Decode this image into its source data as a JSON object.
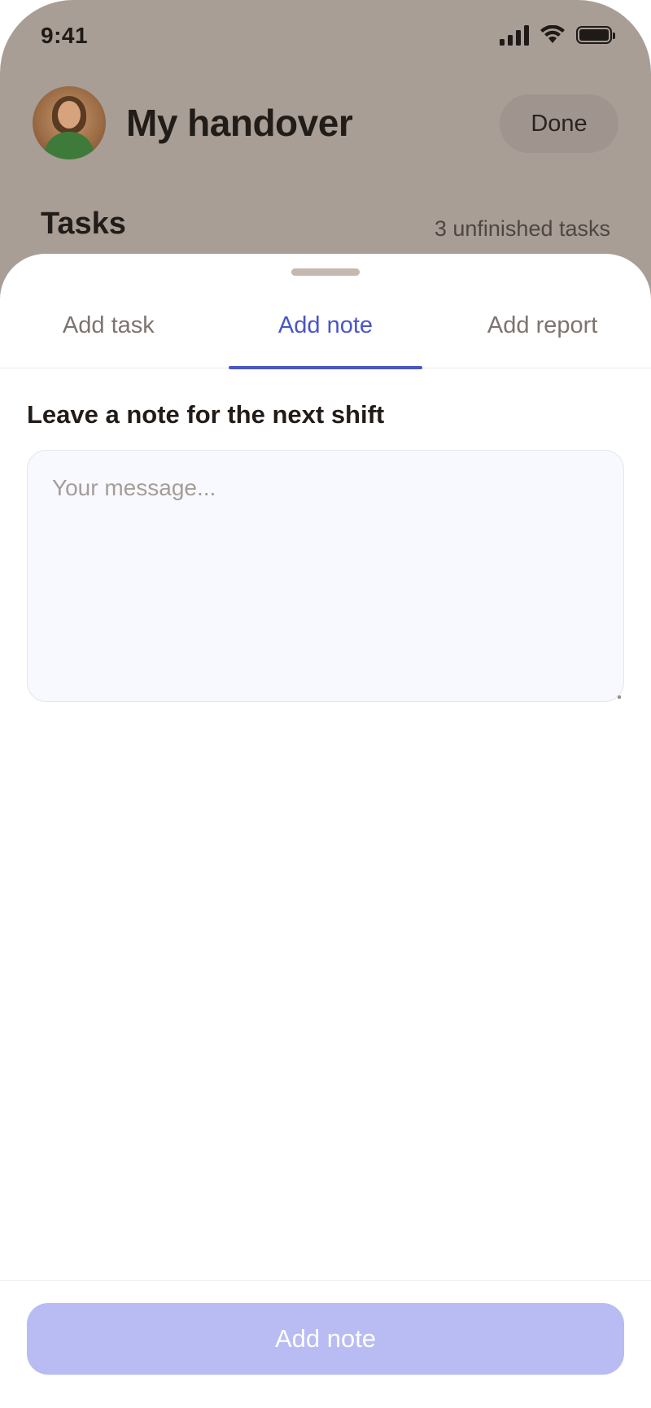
{
  "status_bar": {
    "time": "9:41",
    "icons": [
      "signal-icon",
      "wifi-icon",
      "battery-icon"
    ]
  },
  "header": {
    "title": "My handover",
    "done_label": "Done",
    "avatar": "avatar-icon"
  },
  "tasks": {
    "heading": "Tasks",
    "count_text": "3 unfinished tasks"
  },
  "sheet": {
    "tabs": [
      {
        "label": "Add task",
        "active": false
      },
      {
        "label": "Add note",
        "active": true
      },
      {
        "label": "Add report",
        "active": false
      }
    ],
    "note_label": "Leave a note for the next shift",
    "message": {
      "value": "",
      "placeholder": "Your message..."
    },
    "submit_label": "Add note"
  },
  "colors": {
    "accent": "#4b55c6",
    "button_disabled": "#b8bcf2",
    "backdrop": "#a89e96"
  }
}
